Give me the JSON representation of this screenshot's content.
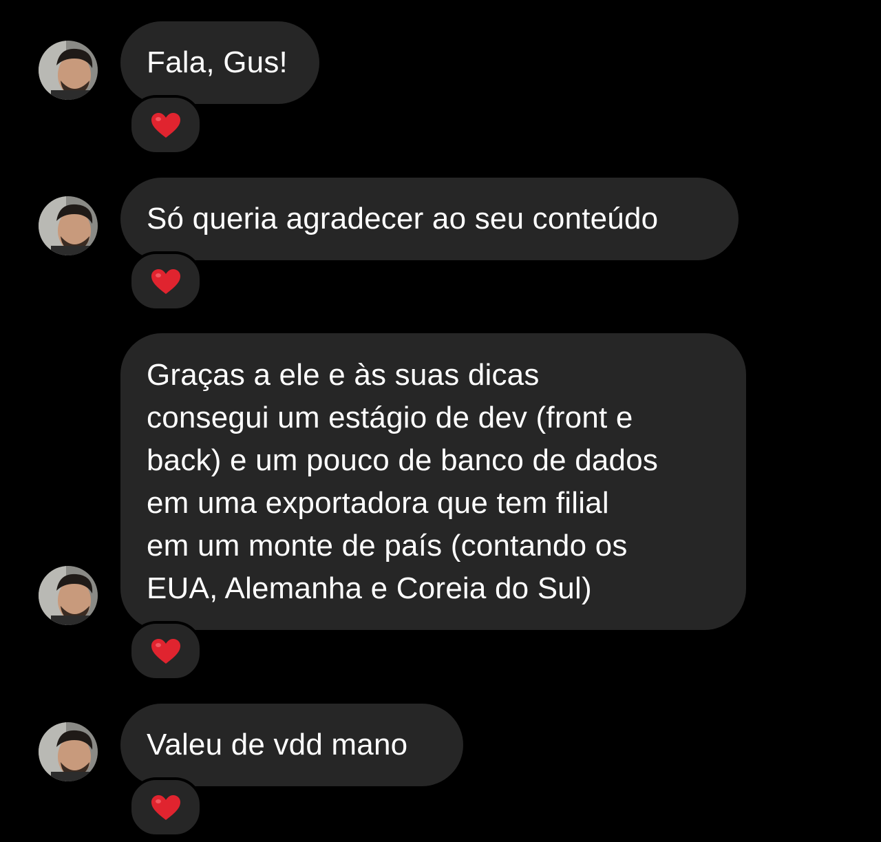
{
  "conversation": {
    "accent_color": "#262626",
    "background_color": "#000000",
    "reaction_emoji": "heart-icon",
    "reaction_color": "#e0242f",
    "messages": [
      {
        "text": "Fala, Gus!",
        "reaction": "❤"
      },
      {
        "text": "Só queria agradecer ao seu conteúdo",
        "reaction": "❤"
      },
      {
        "lines": [
          "Graças a ele e às suas dicas",
          "consegui um estágio de dev (front e",
          "back) e um pouco de banco de dados",
          "em uma exportadora que tem filial",
          "em um monte de país (contando os",
          "EUA, Alemanha e Coreia do Sul)"
        ],
        "reaction": "❤"
      },
      {
        "text": "Valeu de vdd mano",
        "reaction": "❤"
      }
    ]
  }
}
